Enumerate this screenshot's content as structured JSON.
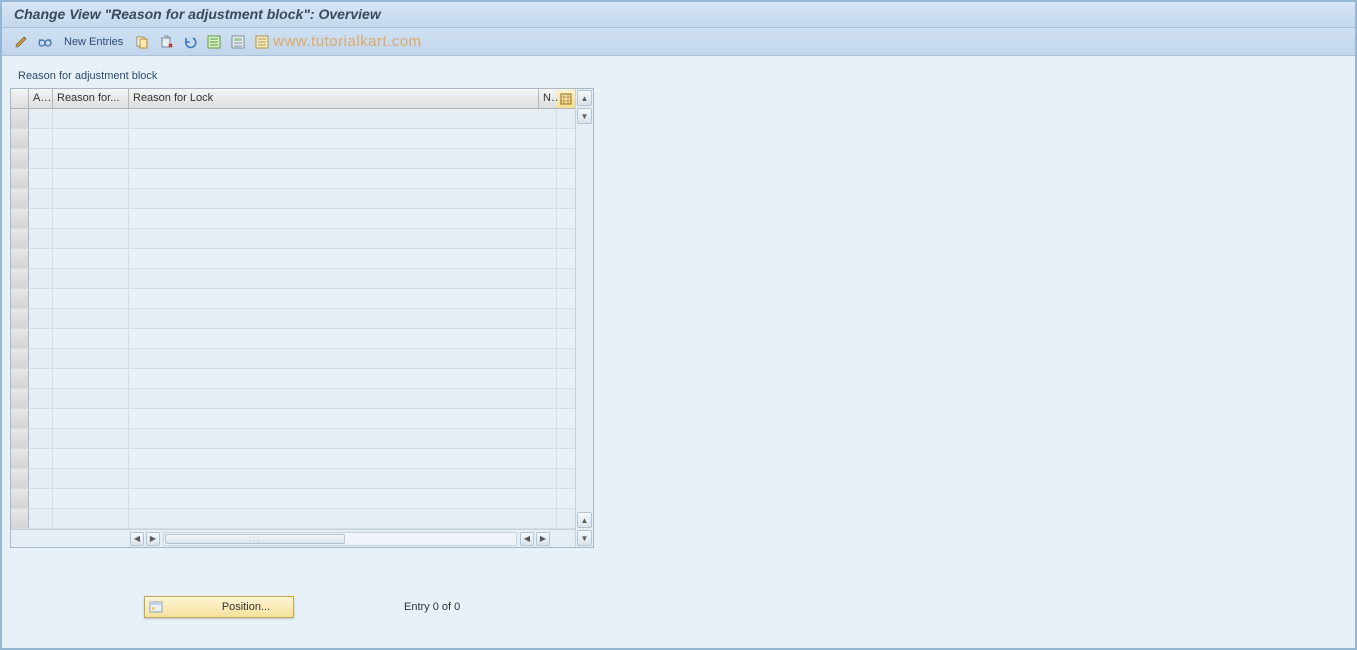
{
  "title": "Change View \"Reason for adjustment block\": Overview",
  "toolbar": {
    "new_entries_label": "New Entries",
    "watermark": "www.tutorialkart.com"
  },
  "table": {
    "title": "Reason for adjustment block",
    "columns": {
      "col_a": "A...",
      "col_reason_for": "Reason for...",
      "col_reason_for_lock": "Reason for Lock",
      "col_na": "Na"
    },
    "row_count": 21,
    "rows": []
  },
  "footer": {
    "position_label": "Position...",
    "entry_text": "Entry 0 of 0"
  }
}
